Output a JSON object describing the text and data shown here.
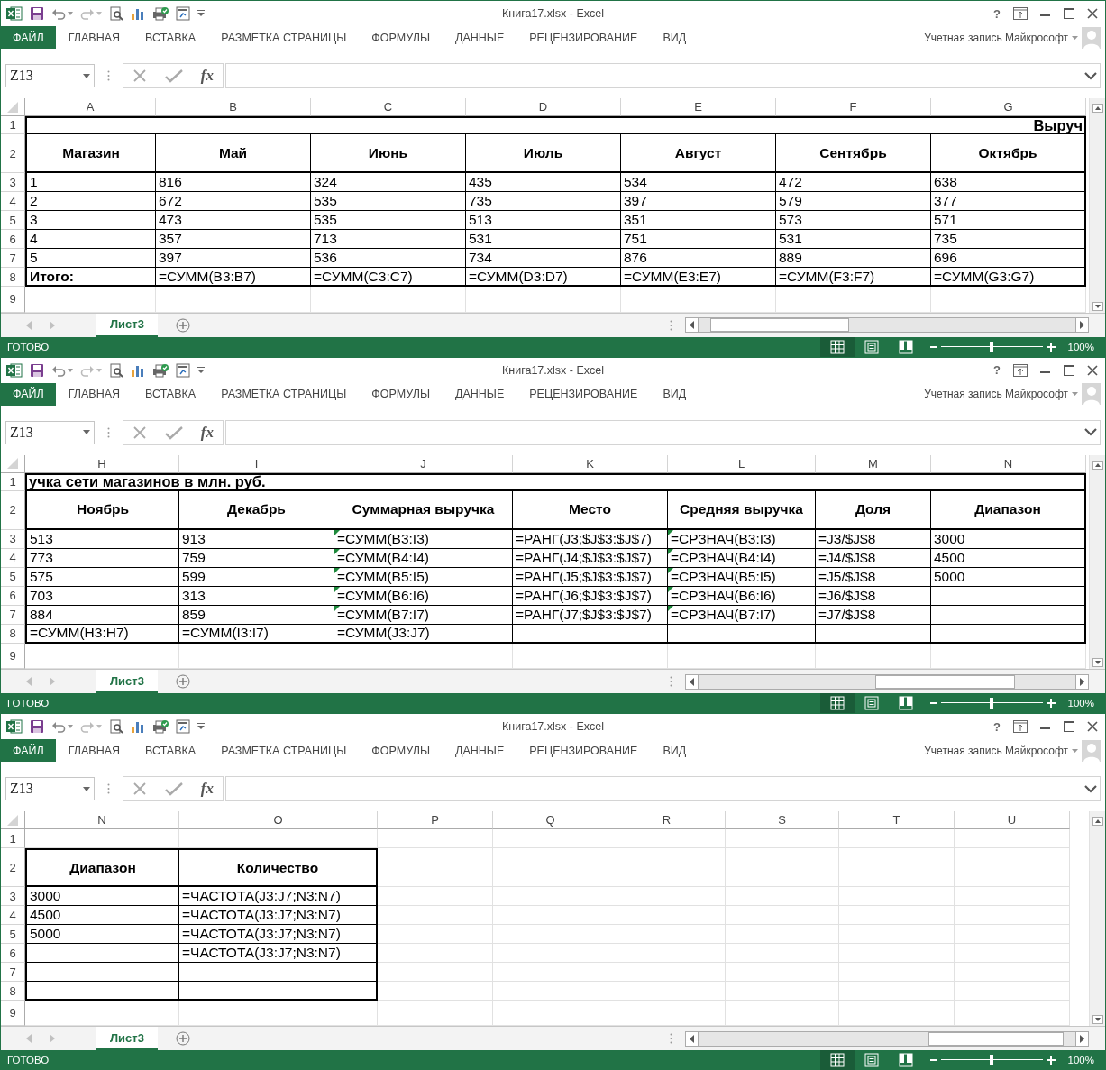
{
  "windows": [
    {
      "title": "Книга17.xlsx - Excel",
      "help": "?",
      "ribbon_tabs": [
        {
          "label": "ФАЙЛ",
          "kind": "file"
        },
        {
          "label": "ГЛАВНАЯ",
          "kind": "tab"
        },
        {
          "label": "ВСТАВКА",
          "kind": "tab"
        },
        {
          "label": "РАЗМЕТКА СТРАНИЦЫ",
          "kind": "tab"
        },
        {
          "label": "ФОРМУЛЫ",
          "kind": "tab"
        },
        {
          "label": "ДАННЫЕ",
          "kind": "tab"
        },
        {
          "label": "РЕЦЕНЗИРОВАНИЕ",
          "kind": "tab"
        },
        {
          "label": "ВИД",
          "kind": "tab"
        }
      ],
      "account": "Учетная запись Майкрософт",
      "name_box": "Z13",
      "fx": "fx",
      "columns": [
        {
          "label": "A",
          "in_table": true
        },
        {
          "label": "B",
          "in_table": true
        },
        {
          "label": "C",
          "in_table": true
        },
        {
          "label": "D",
          "in_table": true
        },
        {
          "label": "E",
          "in_table": true
        },
        {
          "label": "F",
          "in_table": true
        },
        {
          "label": "G",
          "in_table": true
        }
      ],
      "rows": [
        {
          "header": "1",
          "kind": "title",
          "in_table": true,
          "text": "Выруч"
        },
        {
          "header": "2",
          "kind": "header",
          "in_table": true,
          "cells": [
            {
              "text": "Магазин",
              "flagged": false
            },
            {
              "text": "Май",
              "flagged": false
            },
            {
              "text": "Июнь",
              "flagged": false
            },
            {
              "text": "Июль",
              "flagged": false
            },
            {
              "text": "Август",
              "flagged": false
            },
            {
              "text": "Сентябрь",
              "flagged": false
            },
            {
              "text": "Октябрь",
              "flagged": false
            }
          ]
        },
        {
          "header": "3",
          "kind": "data",
          "in_table": true,
          "cells": [
            {
              "text": "1",
              "flagged": false
            },
            {
              "text": "816",
              "flagged": false
            },
            {
              "text": "324",
              "flagged": false
            },
            {
              "text": "435",
              "flagged": false
            },
            {
              "text": "534",
              "flagged": false
            },
            {
              "text": "472",
              "flagged": false
            },
            {
              "text": "638",
              "flagged": false
            }
          ]
        },
        {
          "header": "4",
          "kind": "data",
          "in_table": true,
          "cells": [
            {
              "text": "2",
              "flagged": false
            },
            {
              "text": "672",
              "flagged": false
            },
            {
              "text": "535",
              "flagged": false
            },
            {
              "text": "735",
              "flagged": false
            },
            {
              "text": "397",
              "flagged": false
            },
            {
              "text": "579",
              "flagged": false
            },
            {
              "text": "377",
              "flagged": false
            }
          ]
        },
        {
          "header": "5",
          "kind": "data",
          "in_table": true,
          "cells": [
            {
              "text": "3",
              "flagged": false
            },
            {
              "text": "473",
              "flagged": false
            },
            {
              "text": "535",
              "flagged": false
            },
            {
              "text": "513",
              "flagged": false
            },
            {
              "text": "351",
              "flagged": false
            },
            {
              "text": "573",
              "flagged": false
            },
            {
              "text": "571",
              "flagged": false
            }
          ]
        },
        {
          "header": "6",
          "kind": "data",
          "in_table": true,
          "cells": [
            {
              "text": "4",
              "flagged": false
            },
            {
              "text": "357",
              "flagged": false
            },
            {
              "text": "713",
              "flagged": false
            },
            {
              "text": "531",
              "flagged": false
            },
            {
              "text": "751",
              "flagged": false
            },
            {
              "text": "531",
              "flagged": false
            },
            {
              "text": "735",
              "flagged": false
            }
          ]
        },
        {
          "header": "7",
          "kind": "data",
          "in_table": true,
          "cells": [
            {
              "text": "5",
              "flagged": false
            },
            {
              "text": "397",
              "flagged": false
            },
            {
              "text": "536",
              "flagged": false
            },
            {
              "text": "734",
              "flagged": false
            },
            {
              "text": "876",
              "flagged": false
            },
            {
              "text": "889",
              "flagged": false
            },
            {
              "text": "696",
              "flagged": false
            }
          ]
        },
        {
          "header": "8",
          "kind": "total",
          "in_table": true,
          "cells": [
            {
              "text": "Итого:",
              "flagged": false
            },
            {
              "text": "=СУММ(B3:B7)",
              "flagged": false
            },
            {
              "text": "=СУММ(C3:C7)",
              "flagged": false
            },
            {
              "text": "=СУММ(D3:D7)",
              "flagged": false
            },
            {
              "text": "=СУММ(E3:E7)",
              "flagged": false
            },
            {
              "text": "=СУММ(F3:F7)",
              "flagged": false
            },
            {
              "text": "=СУММ(G3:G7)",
              "flagged": false
            }
          ]
        },
        {
          "header": "9",
          "kind": "blank",
          "in_table": false
        }
      ],
      "sheet_tabs": [
        {
          "label": "Лист3",
          "selected": true
        }
      ],
      "status": {
        "text": "ГОТОВО",
        "views": [
          {
            "kind": "normal",
            "selected": true
          },
          {
            "kind": "layout",
            "selected": false
          },
          {
            "kind": "page_break",
            "selected": false
          }
        ],
        "zoom": {
          "level": 0.5,
          "reading": "100%"
        }
      }
    },
    {
      "title": "Книга17.xlsx - Excel",
      "help": "?",
      "ribbon_tabs": [
        {
          "label": "ФАЙЛ",
          "kind": "file"
        },
        {
          "label": "ГЛАВНАЯ",
          "kind": "tab"
        },
        {
          "label": "ВСТАВКА",
          "kind": "tab"
        },
        {
          "label": "РАЗМЕТКА СТРАНИЦЫ",
          "kind": "tab"
        },
        {
          "label": "ФОРМУЛЫ",
          "kind": "tab"
        },
        {
          "label": "ДАННЫЕ",
          "kind": "tab"
        },
        {
          "label": "РЕЦЕНЗИРОВАНИЕ",
          "kind": "tab"
        },
        {
          "label": "ВИД",
          "kind": "tab"
        }
      ],
      "account": "Учетная запись Майкрософт",
      "name_box": "Z13",
      "fx": "fx",
      "columns": [
        {
          "label": "H",
          "in_table": true
        },
        {
          "label": "I",
          "in_table": true
        },
        {
          "label": "J",
          "in_table": true
        },
        {
          "label": "K",
          "in_table": true
        },
        {
          "label": "L",
          "in_table": true
        },
        {
          "label": "M",
          "in_table": true
        },
        {
          "label": "N",
          "in_table": true
        }
      ],
      "rows": [
        {
          "header": "1",
          "kind": "title",
          "in_table": true,
          "text": "учка сети магазинов в млн. руб."
        },
        {
          "header": "2",
          "kind": "header",
          "in_table": true,
          "cells": [
            {
              "text": "Ноябрь",
              "flagged": false
            },
            {
              "text": "Декабрь",
              "flagged": false
            },
            {
              "text": "Суммарная выручка",
              "flagged": false
            },
            {
              "text": "Место",
              "flagged": false
            },
            {
              "text": "Средняя выручка",
              "flagged": false
            },
            {
              "text": "Доля",
              "flagged": false
            },
            {
              "text": "Диапазон",
              "flagged": false
            }
          ]
        },
        {
          "header": "3",
          "kind": "data",
          "in_table": true,
          "cells": [
            {
              "text": "513",
              "flagged": false
            },
            {
              "text": "913",
              "flagged": false
            },
            {
              "text": "=СУММ(B3:I3)",
              "flagged": true
            },
            {
              "text": "=РАНГ(J3;$J$3:$J$7)",
              "flagged": false
            },
            {
              "text": "=СРЗНАЧ(B3:I3)",
              "flagged": true
            },
            {
              "text": "=J3/$J$8",
              "flagged": false
            },
            {
              "text": "3000",
              "flagged": false
            }
          ]
        },
        {
          "header": "4",
          "kind": "data",
          "in_table": true,
          "cells": [
            {
              "text": "773",
              "flagged": false
            },
            {
              "text": "759",
              "flagged": false
            },
            {
              "text": "=СУММ(B4:I4)",
              "flagged": true
            },
            {
              "text": "=РАНГ(J4;$J$3:$J$7)",
              "flagged": false
            },
            {
              "text": "=СРЗНАЧ(B4:I4)",
              "flagged": true
            },
            {
              "text": "=J4/$J$8",
              "flagged": false
            },
            {
              "text": "4500",
              "flagged": false
            }
          ]
        },
        {
          "header": "5",
          "kind": "data",
          "in_table": true,
          "cells": [
            {
              "text": "575",
              "flagged": false
            },
            {
              "text": "599",
              "flagged": false
            },
            {
              "text": "=СУММ(B5:I5)",
              "flagged": true
            },
            {
              "text": "=РАНГ(J5;$J$3:$J$7)",
              "flagged": false
            },
            {
              "text": "=СРЗНАЧ(B5:I5)",
              "flagged": true
            },
            {
              "text": "=J5/$J$8",
              "flagged": false
            },
            {
              "text": "5000",
              "flagged": false
            }
          ]
        },
        {
          "header": "6",
          "kind": "data",
          "in_table": true,
          "cells": [
            {
              "text": "703",
              "flagged": false
            },
            {
              "text": "313",
              "flagged": false
            },
            {
              "text": "=СУММ(B6:I6)",
              "flagged": true
            },
            {
              "text": "=РАНГ(J6;$J$3:$J$7)",
              "flagged": false
            },
            {
              "text": "=СРЗНАЧ(B6:I6)",
              "flagged": true
            },
            {
              "text": "=J6/$J$8",
              "flagged": false
            },
            null
          ]
        },
        {
          "header": "7",
          "kind": "data",
          "in_table": true,
          "cells": [
            {
              "text": "884",
              "flagged": false
            },
            {
              "text": "859",
              "flagged": false
            },
            {
              "text": "=СУММ(B7:I7)",
              "flagged": true
            },
            {
              "text": "=РАНГ(J7;$J$3:$J$7)",
              "flagged": false
            },
            {
              "text": "=СРЗНАЧ(B7:I7)",
              "flagged": true
            },
            {
              "text": "=J7/$J$8",
              "flagged": false
            },
            null
          ]
        },
        {
          "header": "8",
          "kind": "data",
          "in_table": true,
          "cells": [
            {
              "text": "=СУММ(H3:H7)",
              "flagged": false
            },
            {
              "text": "=СУММ(I3:I7)",
              "flagged": false
            },
            {
              "text": "=СУММ(J3:J7)",
              "flagged": false
            },
            null,
            null,
            null,
            null
          ]
        },
        {
          "header": "9",
          "kind": "blank",
          "in_table": false
        }
      ],
      "sheet_tabs": [
        {
          "label": "Лист3",
          "selected": true
        }
      ],
      "status": {
        "text": "ГОТОВО",
        "views": [
          {
            "kind": "normal",
            "selected": true
          },
          {
            "kind": "layout",
            "selected": false
          },
          {
            "kind": "page_break",
            "selected": false
          }
        ],
        "zoom": {
          "level": 0.5,
          "reading": "100%"
        }
      }
    },
    {
      "title": "Книга17.xlsx - Excel",
      "help": "?",
      "ribbon_tabs": [
        {
          "label": "ФАЙЛ",
          "kind": "file"
        },
        {
          "label": "ГЛАВНАЯ",
          "kind": "tab"
        },
        {
          "label": "ВСТАВКА",
          "kind": "tab"
        },
        {
          "label": "РАЗМЕТКА СТРАНИЦЫ",
          "kind": "tab"
        },
        {
          "label": "ФОРМУЛЫ",
          "kind": "tab"
        },
        {
          "label": "ДАННЫЕ",
          "kind": "tab"
        },
        {
          "label": "РЕЦЕНЗИРОВАНИЕ",
          "kind": "tab"
        },
        {
          "label": "ВИД",
          "kind": "tab"
        }
      ],
      "account": "Учетная запись Майкрософт",
      "name_box": "Z13",
      "fx": "fx",
      "columns": [
        {
          "label": "N",
          "in_table": true
        },
        {
          "label": "O",
          "in_table": true
        },
        {
          "label": "P",
          "in_table": false
        },
        {
          "label": "Q",
          "in_table": false
        },
        {
          "label": "R",
          "in_table": false
        },
        {
          "label": "S",
          "in_table": false
        },
        {
          "label": "T",
          "in_table": false
        },
        {
          "label": "U",
          "in_table": false
        }
      ],
      "rows": [
        {
          "header": "1",
          "kind": "blank",
          "in_table": false
        },
        {
          "header": "2",
          "kind": "header",
          "in_table": true,
          "cells": [
            {
              "text": "Диапазон",
              "flagged": false
            },
            {
              "text": "Количество",
              "flagged": false
            }
          ]
        },
        {
          "header": "3",
          "kind": "data",
          "in_table": true,
          "cells": [
            {
              "text": "3000",
              "flagged": false
            },
            {
              "text": "=ЧАСТОТА(J3:J7;N3:N7)",
              "flagged": false
            }
          ]
        },
        {
          "header": "4",
          "kind": "data",
          "in_table": true,
          "cells": [
            {
              "text": "4500",
              "flagged": false
            },
            {
              "text": "=ЧАСТОТА(J3:J7;N3:N7)",
              "flagged": false
            }
          ]
        },
        {
          "header": "5",
          "kind": "data",
          "in_table": true,
          "cells": [
            {
              "text": "5000",
              "flagged": false
            },
            {
              "text": "=ЧАСТОТА(J3:J7;N3:N7)",
              "flagged": false
            }
          ]
        },
        {
          "header": "6",
          "kind": "data",
          "in_table": true,
          "cells": [
            null,
            {
              "text": "=ЧАСТОТА(J3:J7;N3:N7)",
              "flagged": false
            }
          ]
        },
        {
          "header": "7",
          "kind": "data",
          "in_table": true,
          "cells": [
            null,
            null
          ]
        },
        {
          "header": "8",
          "kind": "data",
          "in_table": true,
          "cells": [
            null,
            null
          ]
        },
        {
          "header": "9",
          "kind": "blank",
          "in_table": false
        }
      ],
      "sheet_tabs": [
        {
          "label": "Лист3",
          "selected": true
        }
      ],
      "status": {
        "text": "ГОТОВО",
        "views": [
          {
            "kind": "normal",
            "selected": true
          },
          {
            "kind": "layout",
            "selected": false
          },
          {
            "kind": "page_break",
            "selected": false
          }
        ],
        "zoom": {
          "level": 0.5,
          "reading": "100%"
        }
      }
    }
  ]
}
